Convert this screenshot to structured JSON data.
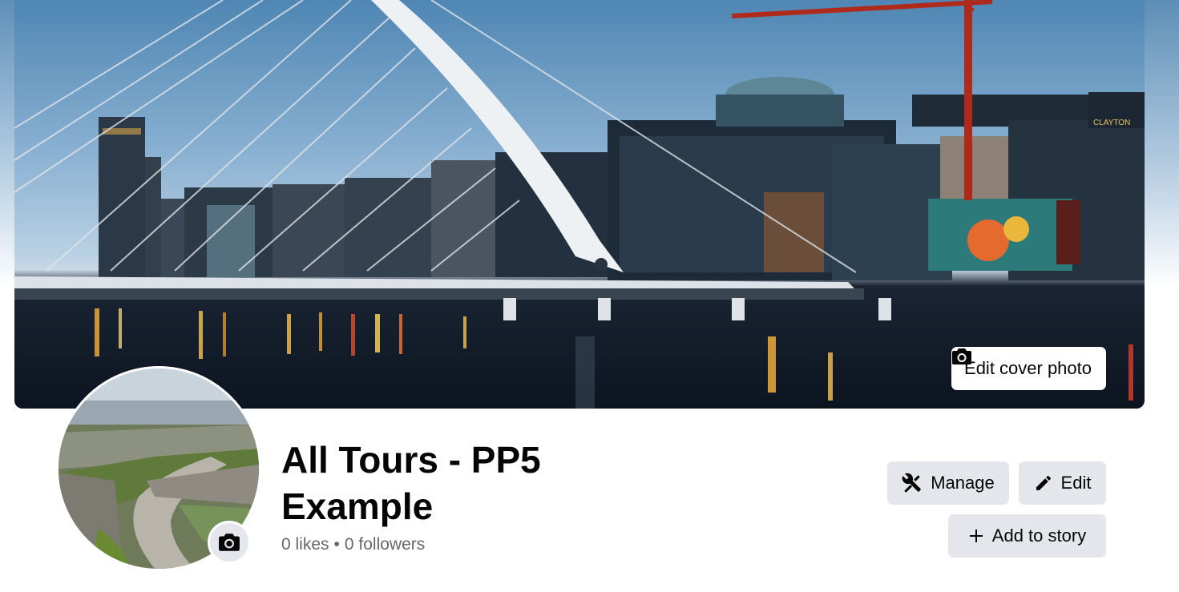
{
  "cover": {
    "edit_cover_label": "Edit cover photo",
    "scene": "city-waterfront-bridge-photo",
    "billboard_text": "CLAYTON"
  },
  "profile": {
    "name": "All Tours - PP5 Example",
    "likes": "0 likes",
    "separator": "•",
    "followers": "0 followers",
    "avatar": "rural-stone-wall-road-photo"
  },
  "actions": {
    "manage_label": "Manage",
    "edit_label": "Edit",
    "add_story_label": "Add to story"
  },
  "icons": {
    "camera": "camera-icon",
    "manage": "tools-icon",
    "edit": "pencil-icon",
    "add": "plus-icon"
  },
  "colors": {
    "button_bg": "#e4e6eb",
    "text_primary": "#050505",
    "text_secondary": "#65676b"
  }
}
